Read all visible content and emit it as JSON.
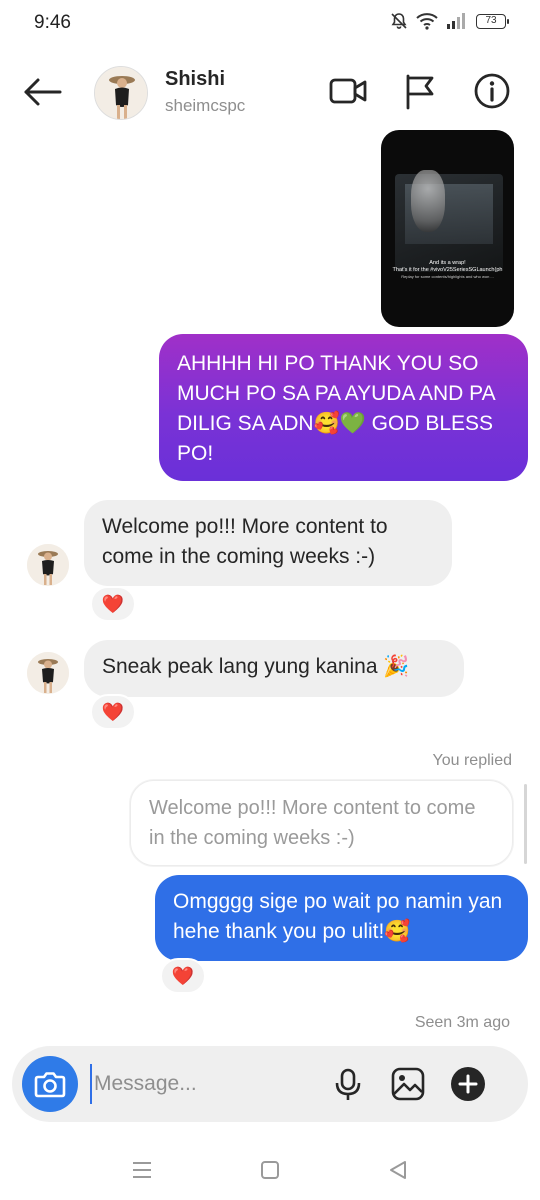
{
  "status_bar": {
    "time": "9:46",
    "battery": "73"
  },
  "header": {
    "name": "Shishi",
    "handle": "sheimcspc",
    "icons": [
      "back-arrow-icon",
      "video-call-icon",
      "flag-icon",
      "info-icon"
    ]
  },
  "story": {
    "caption_line1": "And its a wrap!",
    "caption_line2": "That's it for the #vivoV25SeriesSGLaunch(ph",
    "caption_small": "Replay for some contents/highlights and who won ..."
  },
  "messages": {
    "sent_purple": "AHHHH HI PO THANK YOU SO MUCH PO SA PA AYUDA AND PA DILIG SA ADN🥰💚 GOD BLESS PO!",
    "received_1": "Welcome po!!! More content to come in the coming weeks :-)",
    "received_2": "Sneak peak lang yung kanina 🎉",
    "you_replied_label": "You replied",
    "reply_preview": "Welcome po!!! More content to come in the coming weeks :-)",
    "sent_blue": "Omgggg sige po wait po namin yan hehe thank you po ulit!🥰",
    "seen_label": "Seen 3m ago"
  },
  "reactions": {
    "heart": "❤️"
  },
  "composer": {
    "placeholder": "Message...",
    "icons": [
      "camera-icon",
      "microphone-icon",
      "gallery-icon",
      "add-icon"
    ]
  },
  "colors": {
    "purple_bubble": "#7a32d6",
    "blue_bubble": "#2f6fe7",
    "camera_button": "#2f7be8",
    "received_bubble": "#efefef",
    "heart": "#e0243b"
  }
}
